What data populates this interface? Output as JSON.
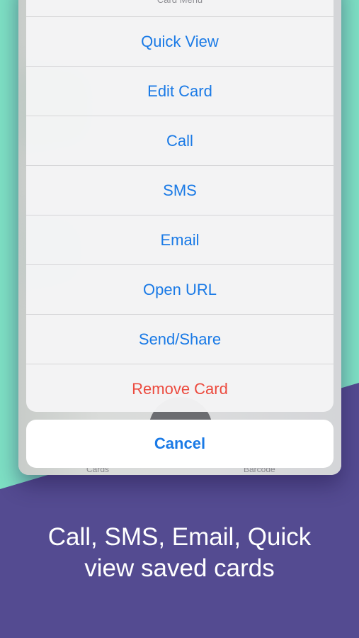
{
  "colors": {
    "mint_background": "#7ee0c4",
    "purple_background": "#544b91",
    "action_blue": "#1a7ae6",
    "destructive_red": "#ec4a3e"
  },
  "action_sheet": {
    "title": "Card Menu",
    "items": [
      {
        "label": "Quick View",
        "style": "default"
      },
      {
        "label": "Edit Card",
        "style": "default"
      },
      {
        "label": "Call",
        "style": "default"
      },
      {
        "label": "SMS",
        "style": "default"
      },
      {
        "label": "Email",
        "style": "default"
      },
      {
        "label": "Open URL",
        "style": "default"
      },
      {
        "label": "Send/Share",
        "style": "default"
      },
      {
        "label": "Remove Card",
        "style": "destructive"
      }
    ],
    "cancel_label": "Cancel"
  },
  "tab_bar": {
    "left_label": "Cards",
    "right_label": "Barcode"
  },
  "caption": {
    "line1": "Call, SMS, Email, Quick",
    "line2": "view saved cards"
  }
}
